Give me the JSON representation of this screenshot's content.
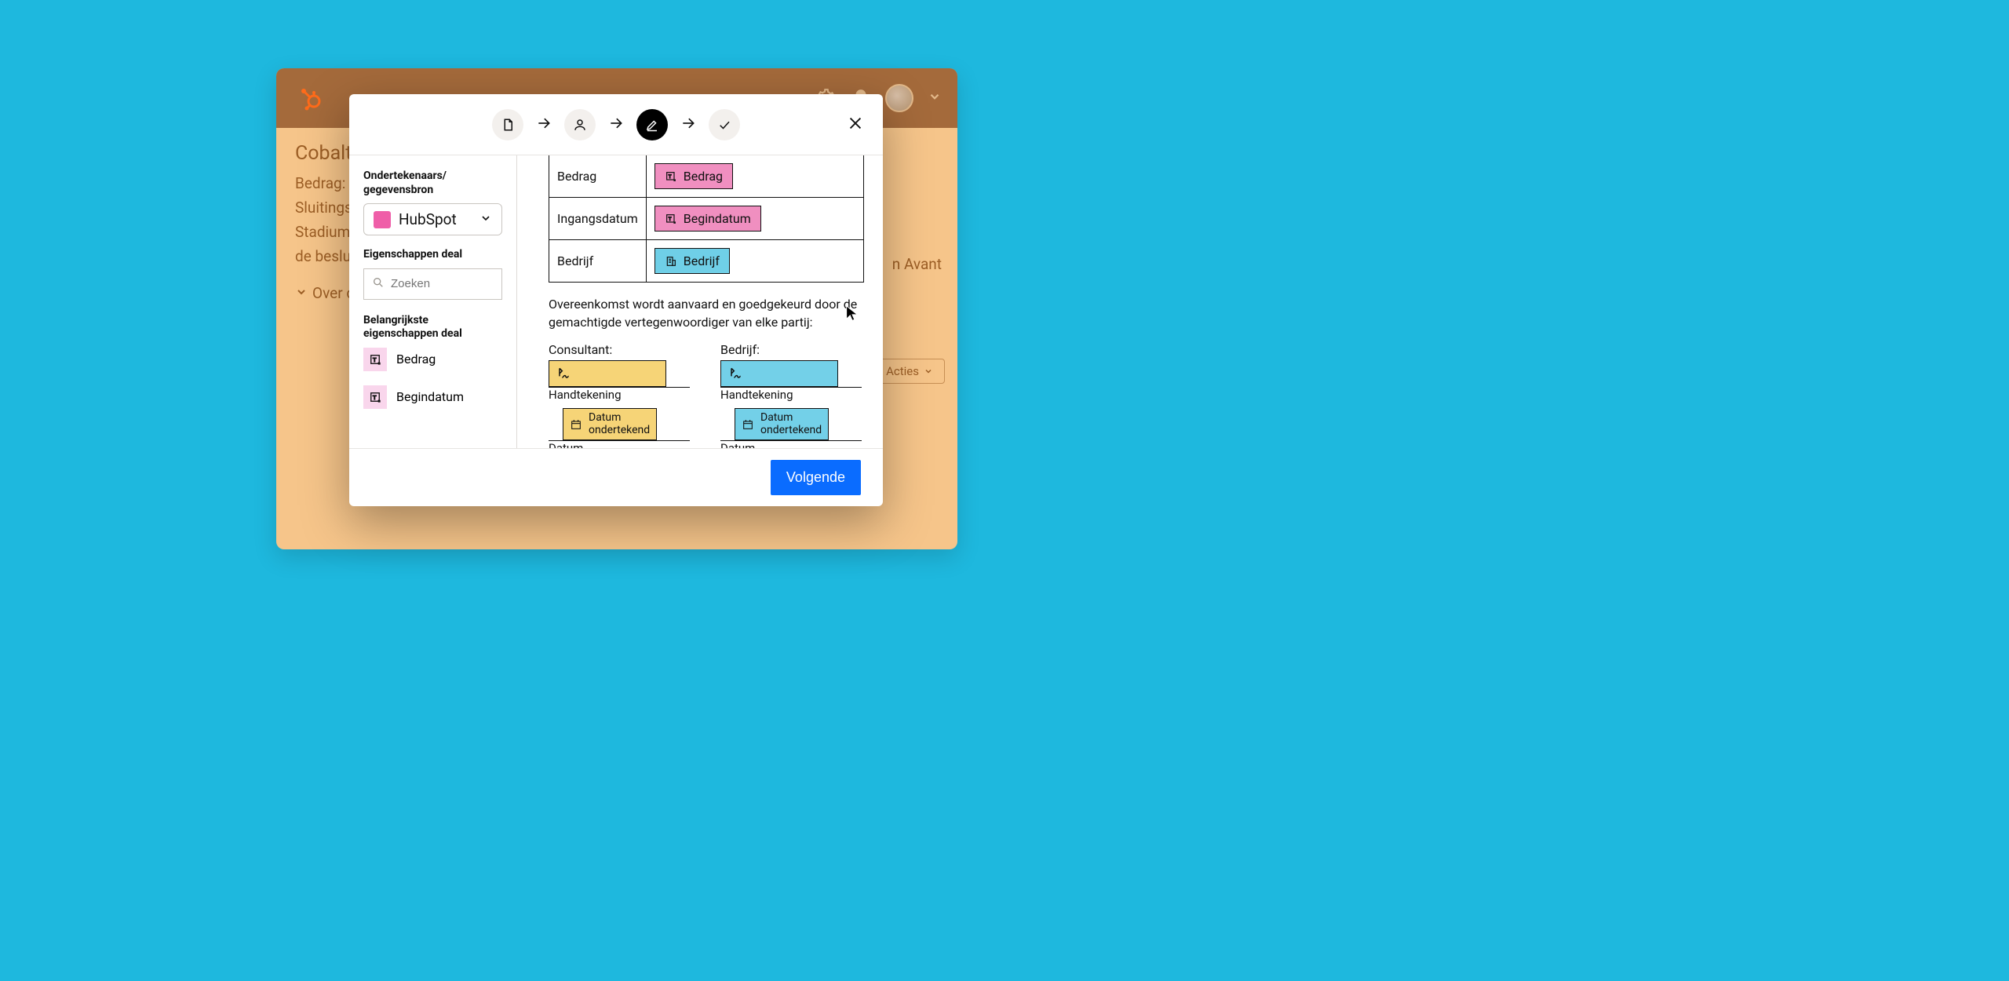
{
  "app": {
    "deal_title": "Cobalt Ci",
    "amount_label": "Bedrag: $",
    "close_label": "Sluitingsd",
    "stage_label_1": "Stadium: I",
    "stage_label_2": "de besluit",
    "about_label": "Over d",
    "side_text": "n Avant",
    "actions_label": "Acties"
  },
  "modal": {
    "left": {
      "signers_label": "Ondertekenaars/ gegevensbron",
      "source_name": "HubSpot",
      "props_label": "Eigenschappen deal",
      "search_placeholder": "Zoeken",
      "key_props_label": "Belangrijkste eigenschappen deal",
      "key_items": [
        "Bedrag",
        "Begindatum"
      ]
    },
    "table": {
      "rows": [
        {
          "label": "Bedrag",
          "token": "Bedrag",
          "style": "pink",
          "icon": "text"
        },
        {
          "label": "Ingangsdatum",
          "token": "Begindatum",
          "style": "pink",
          "icon": "text"
        },
        {
          "label": "Bedrijf",
          "token": "Bedrijf",
          "style": "blue",
          "icon": "company"
        }
      ]
    },
    "agreement_text": "Overeenkomst wordt aanvaard en goedgekeurd door de gemachtigde vertegenwoordiger van elke partij:",
    "sig": {
      "left_title": "Consultant:",
      "right_title": "Bedrijf:",
      "hand_label": "Handtekening",
      "date_box_l1": "Datum",
      "date_box_l2": "ondertekend",
      "date_label": "Datum"
    },
    "next_button": "Volgende"
  },
  "colors": {
    "bg": "#1eb8de",
    "app_bg": "#f6c58a",
    "app_header": "#a46a3b",
    "pink": "#f08fc0",
    "blue": "#6fcfe7",
    "yellow": "#f6d477",
    "primary": "#0a6cff"
  }
}
